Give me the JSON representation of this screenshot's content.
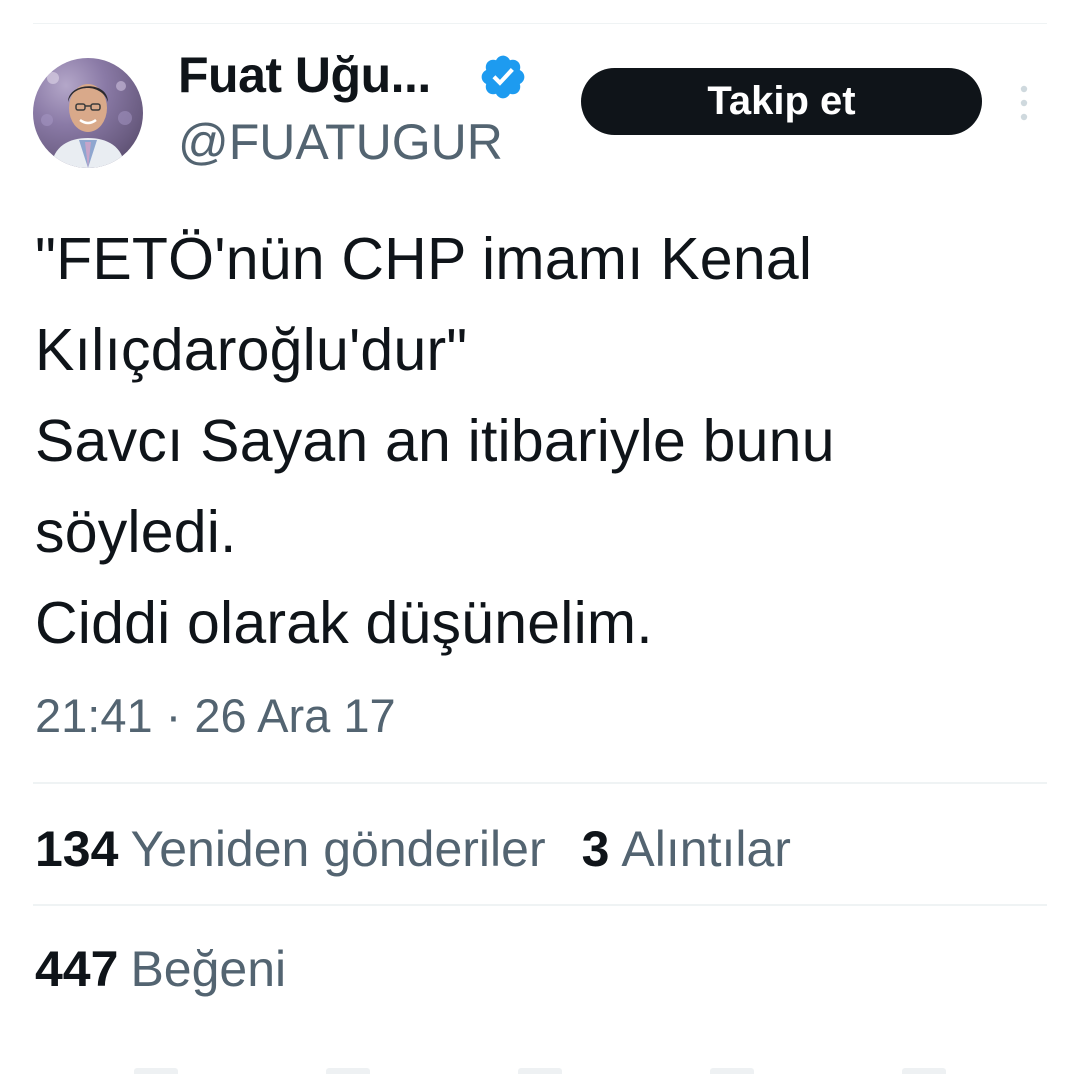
{
  "header": {
    "display_name": "Fuat Uğu...",
    "handle": "@FUATUGUR",
    "verified": true,
    "follow_label": "Takip et",
    "more_icon": "more-vertical-icon",
    "verified_icon": "verified-badge-icon"
  },
  "tweet": {
    "lines": [
      "\"FETÖ'nün CHP imamı Kenal",
      "Kılıçdaroğlu'dur\"",
      "Savcı Sayan an itibariyle bunu",
      "söyledi.",
      "Ciddi olarak düşünelim."
    ],
    "timestamp": "21:41 · 26 Ara 17"
  },
  "stats": {
    "retweets_count": "134",
    "retweets_label": "Yeniden gönderiler",
    "quotes_count": "3",
    "quotes_label": "Alıntılar",
    "likes_count": "447",
    "likes_label": "Beğeni"
  },
  "colors": {
    "text_primary": "#0f1419",
    "text_secondary": "#536471",
    "verified_blue": "#1d9bf0",
    "divider": "#eff3f4",
    "follow_bg": "#0f1419"
  }
}
